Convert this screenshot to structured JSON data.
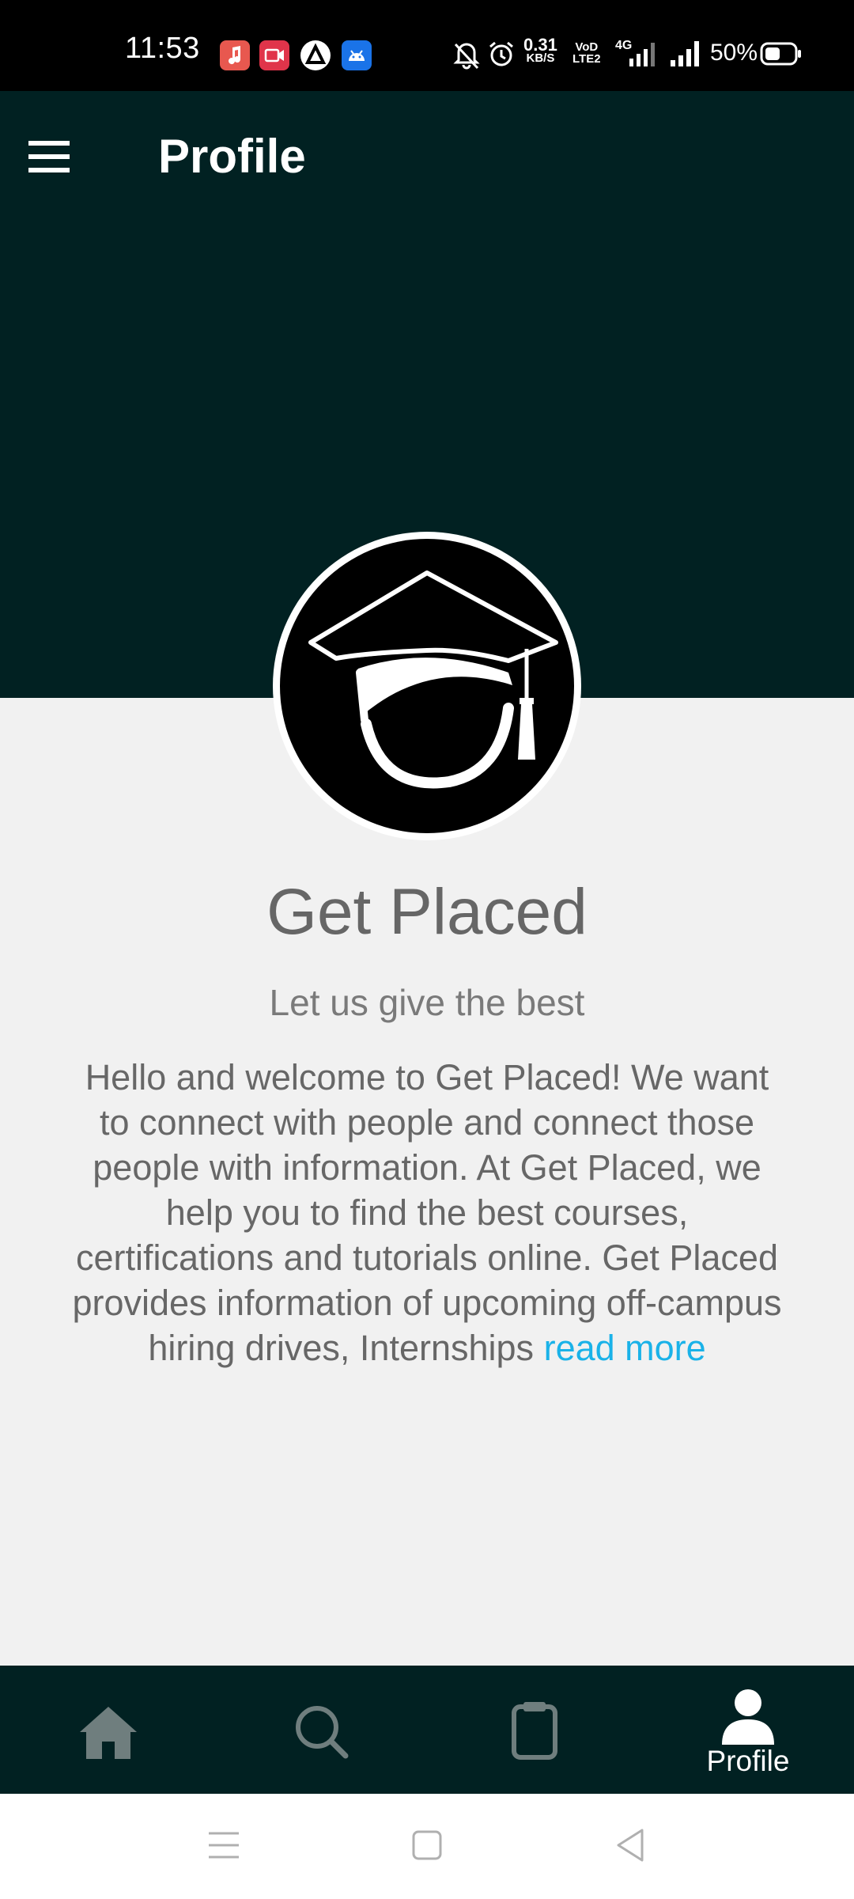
{
  "status_bar": {
    "time": "11:53",
    "net_speed_value": "0.31",
    "net_speed_unit": "KB/S",
    "volte_top": "VoD",
    "volte_bottom": "LTE2",
    "network_type": "4G",
    "battery_percent": "50%",
    "notification_icons": [
      "music-app-icon",
      "screen-recorder-icon",
      "react-app-icon",
      "android-icon"
    ]
  },
  "header": {
    "title": "Profile",
    "menu_icon": "hamburger-menu-icon"
  },
  "profile": {
    "logo_icon": "graduation-cap-icon",
    "name": "Get Placed",
    "tagline": "Let us give the best",
    "description": "Hello and welcome to Get Placed! We want to connect with people and connect those people with information. At Get Placed, we help you to find the best courses, certifications and tutorials online. Get Placed provides information of upcoming off-campus hiring drives, Internships",
    "read_more": "read more"
  },
  "bottom_nav": {
    "items": [
      {
        "icon": "home-icon",
        "label": "",
        "active": false
      },
      {
        "icon": "search-icon",
        "label": "",
        "active": false
      },
      {
        "icon": "clipboard-icon",
        "label": "",
        "active": false
      },
      {
        "icon": "person-icon",
        "label": "Profile",
        "active": true
      }
    ]
  },
  "colors": {
    "header_bg": "#012122",
    "page_bg": "#f1f1f1",
    "link": "#1ab2e8",
    "inactive_icon": "#6f7e7e"
  }
}
